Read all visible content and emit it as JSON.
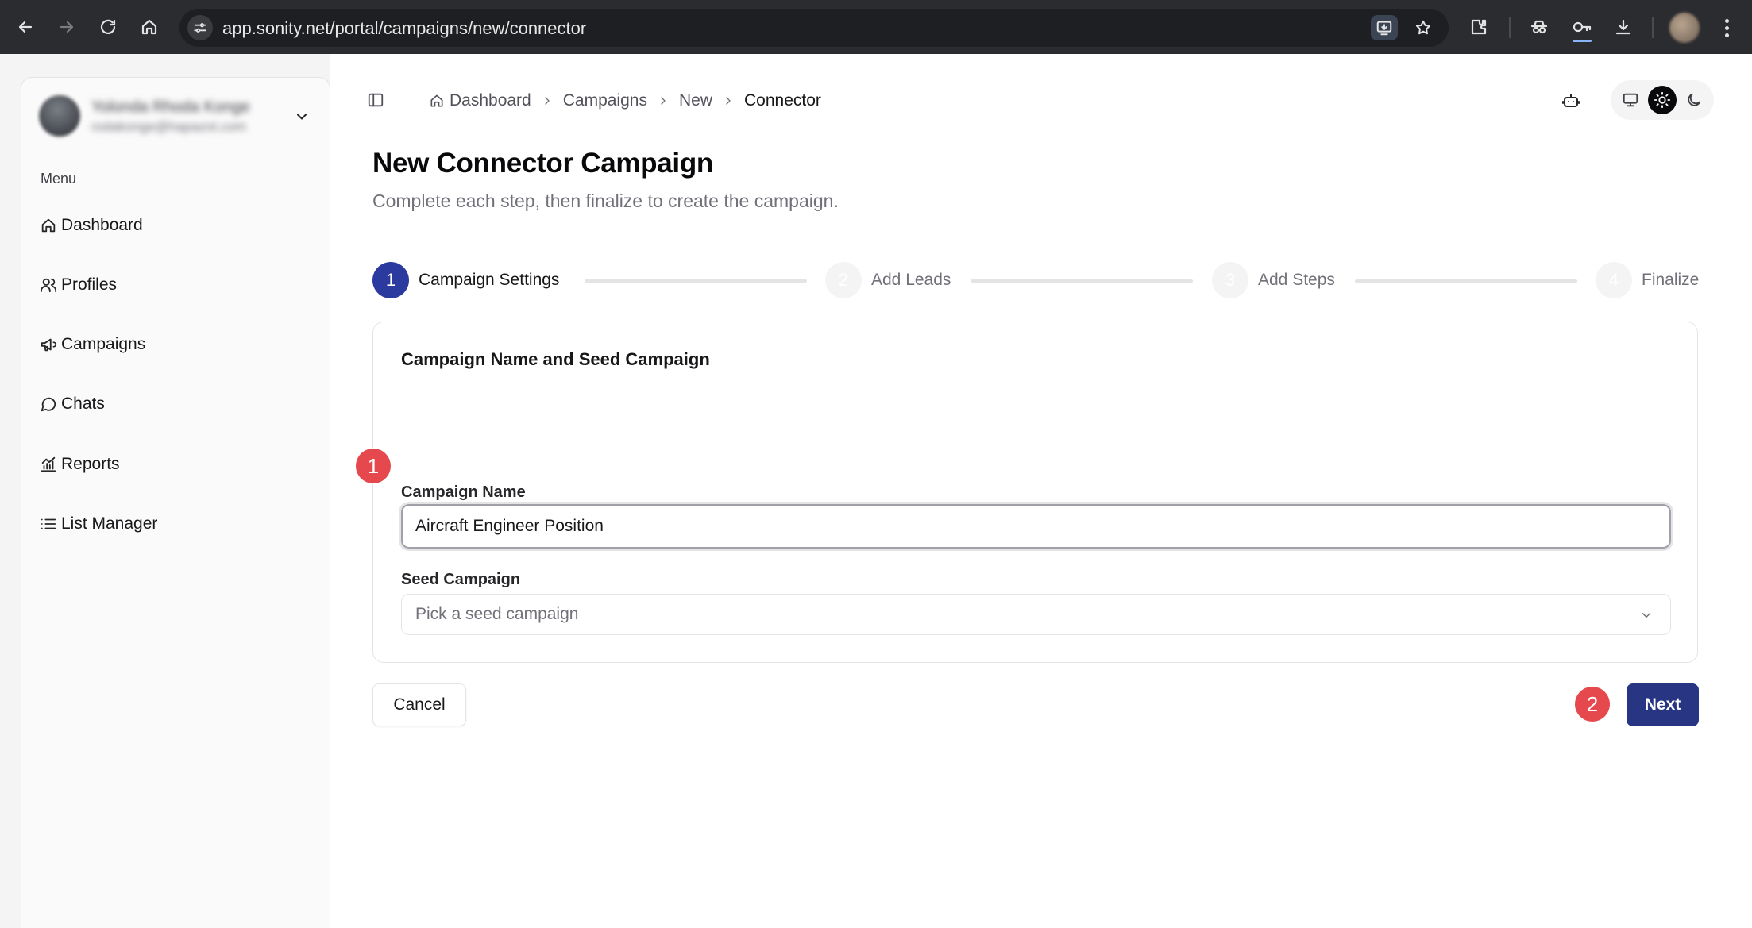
{
  "browser": {
    "url": "app.sonity.net/portal/campaigns/new/connector"
  },
  "sidebar": {
    "account_name": "Yolonda Rhoda Konge",
    "account_email": "rodakonge@hapazot.com",
    "menu_label": "Menu",
    "items": [
      {
        "label": "Dashboard",
        "icon": "home-icon"
      },
      {
        "label": "Profiles",
        "icon": "users-icon"
      },
      {
        "label": "Campaigns",
        "icon": "megaphone-icon"
      },
      {
        "label": "Chats",
        "icon": "chat-bubble-icon"
      },
      {
        "label": "Reports",
        "icon": "bar-chart-icon"
      },
      {
        "label": "List Manager",
        "icon": "list-icon"
      }
    ]
  },
  "breadcrumb": {
    "items": [
      "Dashboard",
      "Campaigns",
      "New",
      "Connector"
    ]
  },
  "page": {
    "title": "New Connector Campaign",
    "subtitle": "Complete each step, then finalize to create the campaign."
  },
  "stepper": {
    "steps": [
      {
        "number": "1",
        "label": "Campaign Settings",
        "state": "active"
      },
      {
        "number": "2",
        "label": "Add Leads",
        "state": "inactive"
      },
      {
        "number": "3",
        "label": "Add Steps",
        "state": "inactive"
      },
      {
        "number": "4",
        "label": "Finalize",
        "state": "inactive"
      }
    ]
  },
  "form": {
    "card_title": "Campaign Name and Seed Campaign",
    "campaign_name_label": "Campaign Name",
    "campaign_name_value": "Aircraft Engineer Position",
    "seed_label": "Seed Campaign",
    "seed_placeholder": "Pick a seed campaign"
  },
  "annotations": {
    "badge_1": "1",
    "badge_2": "2"
  },
  "actions": {
    "cancel_label": "Cancel",
    "next_label": "Next"
  },
  "colors": {
    "accent": "#283583",
    "step_active": "#2b3a9e",
    "annotation_badge": "#e5484d"
  }
}
